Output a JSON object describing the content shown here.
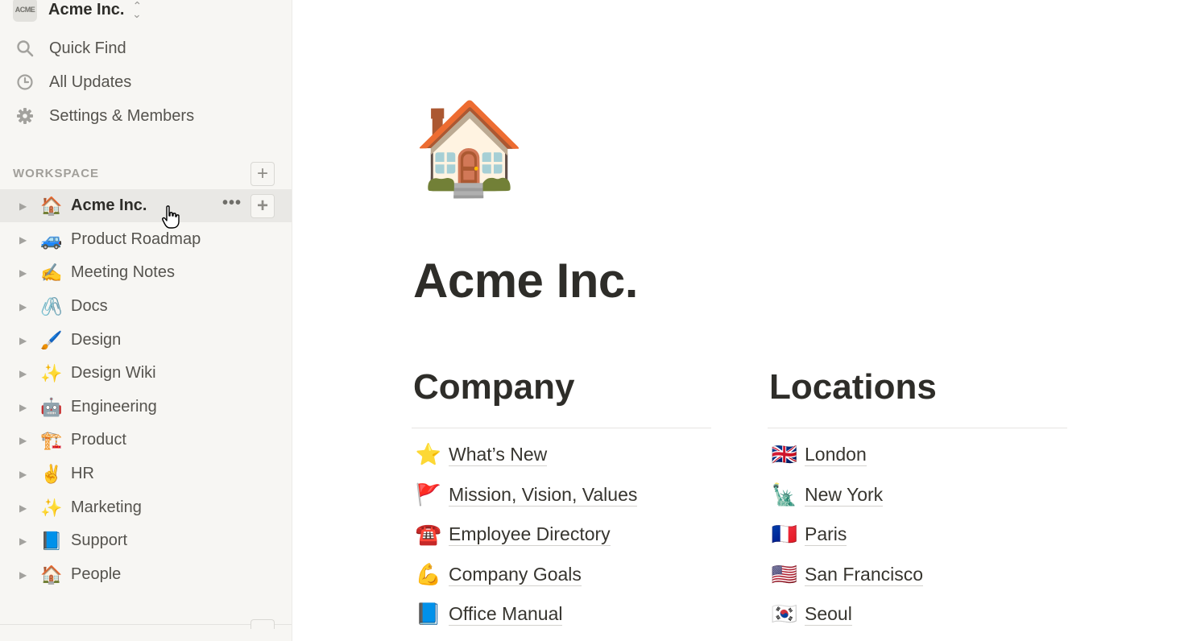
{
  "workspace": {
    "logo_text": "ACME",
    "name": "Acme Inc.",
    "switcher_icon": "chevron-updown-icon"
  },
  "sidebar": {
    "top_items": [
      {
        "label": "Quick Find",
        "icon": "search-icon"
      },
      {
        "label": "All Updates",
        "icon": "clock-icon"
      },
      {
        "label": "Settings & Members",
        "icon": "gear-icon"
      }
    ],
    "section_label": "WORKSPACE",
    "pages": [
      {
        "emoji": "🏠",
        "label": "Acme Inc.",
        "active": true
      },
      {
        "emoji": "🚙",
        "label": "Product Roadmap"
      },
      {
        "emoji": "✍️",
        "label": "Meeting Notes"
      },
      {
        "emoji": "🖇️",
        "label": "Docs"
      },
      {
        "emoji": "🖌️",
        "label": "Design"
      },
      {
        "emoji": "✨",
        "label": "Design Wiki"
      },
      {
        "emoji": "🤖",
        "label": "Engineering"
      },
      {
        "emoji": "🏗️",
        "label": "Product"
      },
      {
        "emoji": "✌️",
        "label": "HR"
      },
      {
        "emoji": "✨",
        "label": "Marketing"
      },
      {
        "emoji": "📘",
        "label": "Support"
      },
      {
        "emoji": "🏠",
        "label": "People"
      }
    ],
    "more_glyph": "•••",
    "plus_glyph": "+"
  },
  "main": {
    "page_icon": "🏠",
    "title": "Acme Inc.",
    "columns": [
      {
        "heading": "Company",
        "links": [
          {
            "emoji": "⭐",
            "label": "What’s New"
          },
          {
            "emoji": "🚩",
            "label": "Mission, Vision, Values"
          },
          {
            "emoji": "☎️",
            "label": "Employee Directory"
          },
          {
            "emoji": "💪",
            "label": "Company Goals"
          },
          {
            "emoji": "📘",
            "label": "Office Manual"
          }
        ]
      },
      {
        "heading": "Locations",
        "links": [
          {
            "emoji": "🇬🇧",
            "label": "London"
          },
          {
            "emoji": "🗽",
            "label": "New York"
          },
          {
            "emoji": "🇫🇷",
            "label": "Paris"
          },
          {
            "emoji": "🇺🇸",
            "label": "San Francisco"
          },
          {
            "emoji": "🇰🇷",
            "label": "Seoul"
          }
        ]
      }
    ]
  }
}
